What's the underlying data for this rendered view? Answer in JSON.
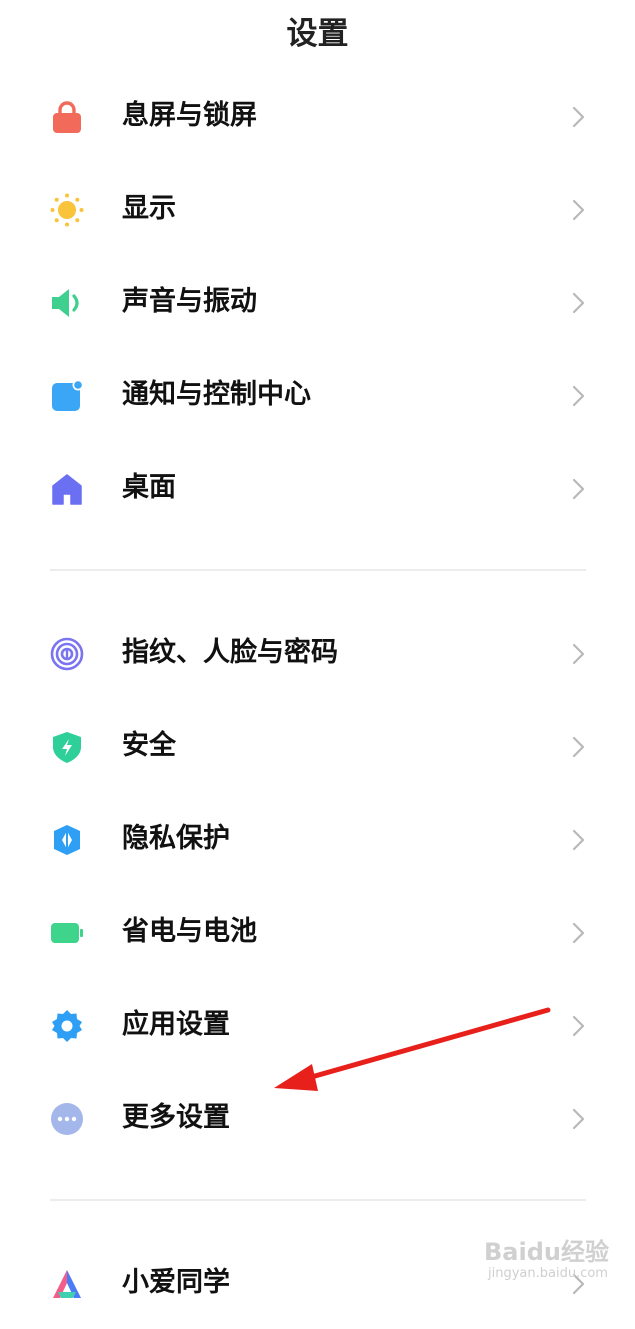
{
  "header": {
    "title": "设置"
  },
  "group1": [
    {
      "label": "息屏与锁屏",
      "icon": "lock-icon",
      "color": "#f26b5a"
    },
    {
      "label": "显示",
      "icon": "sun-icon",
      "color": "#f9c33a"
    },
    {
      "label": "声音与振动",
      "icon": "speaker-icon",
      "color": "#3fcf8e"
    },
    {
      "label": "通知与控制中心",
      "icon": "notification-icon",
      "color": "#3aa6f5"
    },
    {
      "label": "桌面",
      "icon": "home-icon",
      "color": "#6b6ff2"
    }
  ],
  "group2": [
    {
      "label": "指纹、人脸与密码",
      "icon": "fingerprint-icon",
      "color": "#7b74f0"
    },
    {
      "label": "安全",
      "icon": "shield-icon",
      "color": "#2fcf9a"
    },
    {
      "label": "隐私保护",
      "icon": "privacy-icon",
      "color": "#2e9ff5"
    },
    {
      "label": "省电与电池",
      "icon": "battery-icon",
      "color": "#3fd48c"
    },
    {
      "label": "应用设置",
      "icon": "gear-icon",
      "color": "#2e9ff5"
    },
    {
      "label": "更多设置",
      "icon": "more-icon",
      "color": "#a4b7ea"
    }
  ],
  "group3": [
    {
      "label": "小爱同学",
      "icon": "xiaoai-icon",
      "color": "#4b7cf5"
    }
  ],
  "annotation": {
    "color": "#e8201c"
  },
  "watermark": {
    "brand": "Baidu经验",
    "url": "jingyan.baidu.com"
  }
}
